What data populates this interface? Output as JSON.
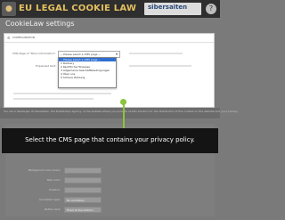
{
  "header": {
    "logo_icon": "cookie-logo-icon",
    "app_title": "EU LEGAL COOKIE LAW",
    "brand": {
      "name": "sibersaiten",
      "tagline": ""
    },
    "help_icon": "help-icon",
    "help_glyph": "?"
  },
  "page_title": "CookieLaw settings",
  "panel": {
    "header_icon": "gear-icon",
    "header_label": "CONFIGURATION",
    "cms_page_label": "CMS Page of \"More information\":",
    "expandable_label": "Expanded text:",
    "select_value": "-- Please select a CMS page --",
    "select_caret": "▾",
    "options": [
      "-- Please select a CMS page --",
      "1 Delivery",
      "2 Rechtliche Hinweise",
      "3 Allgemeine Geschäftsbedingungen",
      "4 Über uns",
      "5 Sichere Zahlung"
    ],
    "selected_index": 0
  },
  "notice_text": "You are a developer of sibersaiten, the Prestashop agency, is the website where you provide us this solution for the distribution of the cookies on the website and your privacy",
  "lower_form": {
    "labels": [
      "Background color (hex):",
      "Text color:",
      "Position:",
      "Animation type:",
      "Button text:"
    ],
    "fields": [
      "",
      "",
      "",
      "No animation",
      "Fixed at the bottom"
    ]
  },
  "tooltip": {
    "text": "Select the CMS page that contains your privacy policy."
  },
  "colors": {
    "accent_green": "#8cc43a",
    "selected_option": "#2e6fd1",
    "title_gold": "#e4c060"
  }
}
